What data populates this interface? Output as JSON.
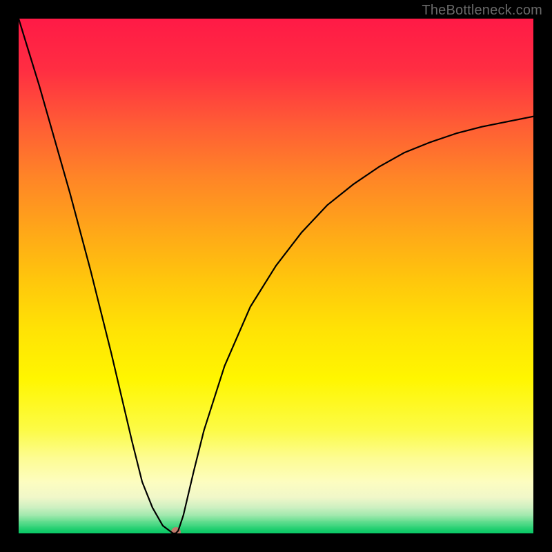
{
  "watermark": "TheBottleneck.com",
  "chart_data": {
    "type": "line",
    "title": "",
    "xlabel": "",
    "ylabel": "",
    "x": [
      0.0,
      0.02,
      0.04,
      0.06,
      0.08,
      0.1,
      0.12,
      0.14,
      0.16,
      0.18,
      0.2,
      0.22,
      0.24,
      0.26,
      0.28,
      0.3,
      0.305,
      0.31,
      0.32,
      0.34,
      0.36,
      0.4,
      0.45,
      0.5,
      0.55,
      0.6,
      0.65,
      0.7,
      0.75,
      0.8,
      0.85,
      0.9,
      0.95,
      1.0
    ],
    "values": [
      1.0,
      0.935,
      0.87,
      0.8,
      0.73,
      0.66,
      0.585,
      0.51,
      0.43,
      0.35,
      0.265,
      0.18,
      0.1,
      0.05,
      0.015,
      0.0,
      0.0,
      0.005,
      0.035,
      0.12,
      0.2,
      0.325,
      0.44,
      0.52,
      0.585,
      0.638,
      0.678,
      0.712,
      0.74,
      0.76,
      0.777,
      0.79,
      0.8,
      0.81
    ],
    "xlim": [
      0,
      1
    ],
    "ylim": [
      0,
      1
    ],
    "marker": {
      "x": 0.305,
      "y": 0.0
    },
    "gradient_stops": [
      {
        "pos": 0.0,
        "color": "#ff1a46"
      },
      {
        "pos": 0.1,
        "color": "#ff2e42"
      },
      {
        "pos": 0.2,
        "color": "#ff5a36"
      },
      {
        "pos": 0.3,
        "color": "#ff8228"
      },
      {
        "pos": 0.4,
        "color": "#ffa31a"
      },
      {
        "pos": 0.5,
        "color": "#ffc40d"
      },
      {
        "pos": 0.6,
        "color": "#ffe205"
      },
      {
        "pos": 0.7,
        "color": "#fff600"
      },
      {
        "pos": 0.8,
        "color": "#fcfb48"
      },
      {
        "pos": 0.85,
        "color": "#fdfc8f"
      },
      {
        "pos": 0.9,
        "color": "#fdfdc0"
      },
      {
        "pos": 0.93,
        "color": "#f0f7c9"
      },
      {
        "pos": 0.95,
        "color": "#c9efc0"
      },
      {
        "pos": 0.965,
        "color": "#9de8ab"
      },
      {
        "pos": 0.975,
        "color": "#6cdf93"
      },
      {
        "pos": 0.985,
        "color": "#3bd57d"
      },
      {
        "pos": 0.992,
        "color": "#1bcd6d"
      },
      {
        "pos": 1.0,
        "color": "#06c765"
      }
    ]
  }
}
